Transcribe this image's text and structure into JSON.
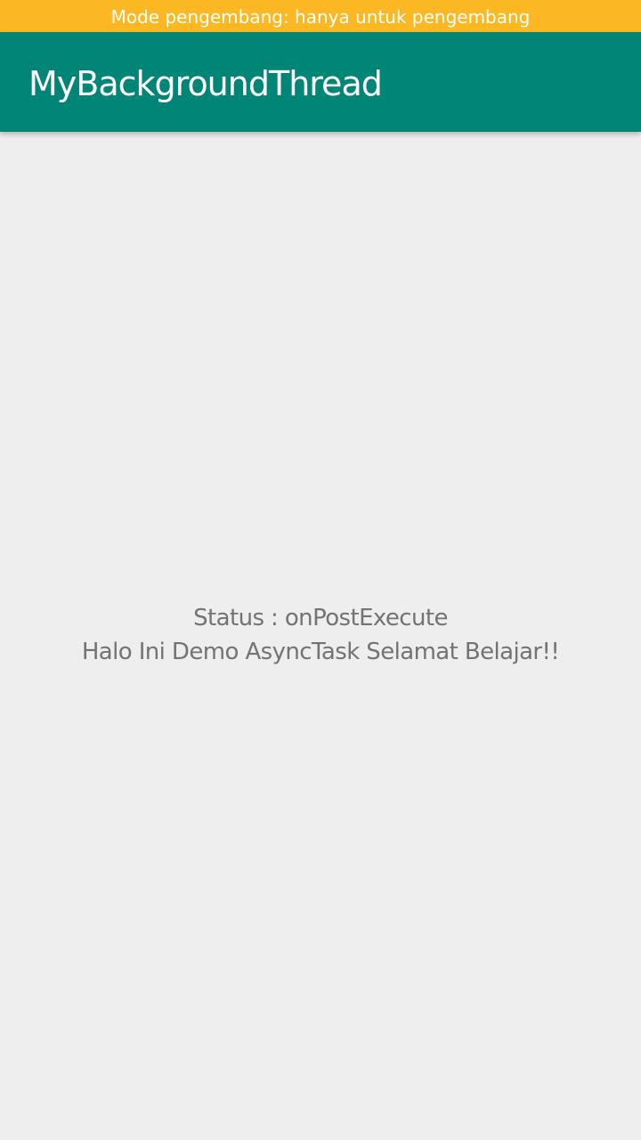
{
  "status_banner": {
    "text": "Mode pengembang: hanya untuk pengembang"
  },
  "app_bar": {
    "title": "MyBackgroundThread"
  },
  "main": {
    "status_text": "Status : onPostExecute",
    "message_text": "Halo Ini Demo AsyncTask Selamat Belajar!!"
  },
  "colors": {
    "banner": "#FBB823",
    "app_bar": "#008577",
    "background": "#EEEEEE",
    "text": "#737373"
  }
}
